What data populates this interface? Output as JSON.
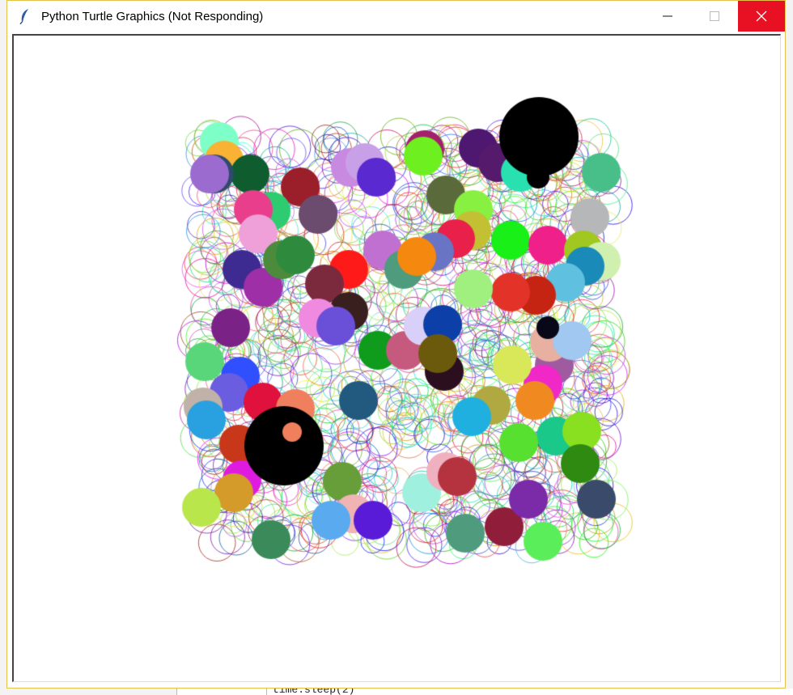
{
  "window": {
    "title": "Python Turtle Graphics (Not Responding)",
    "icon": "feather-icon",
    "controls": {
      "minimize": "minimize-icon",
      "maximize": "maximize-icon",
      "close": "close-icon"
    },
    "close_color": "#e81123"
  },
  "background_editor": {
    "code_line": "time.sleep(2)"
  },
  "canvas": {
    "background": "#ffffff",
    "outline_circles": 900,
    "filled_colors": [
      "#7fffc8",
      "#f9b233",
      "#2d4b6b",
      "#0f5c2f",
      "#9b1f2a",
      "#2ecc71",
      "#e83e8c",
      "#f0a0d8",
      "#6b4c6e",
      "#3d2b91",
      "#9e2fa6",
      "#2e8b3e",
      "#4b8b3b",
      "#ff1a1a",
      "#7b2a3d",
      "#f08ae0",
      "#3a1f1f",
      "#6a4fd9",
      "#7b2287",
      "#5ad67a",
      "#3050ff",
      "#6a5de0",
      "#e0113c",
      "#c0b2a8",
      "#29a0e0",
      "#f07f5e",
      "#c8371a",
      "#e01be0",
      "#d49a2a",
      "#b9e64a",
      "#689e3a",
      "#3a8a5a",
      "#5aaaf0",
      "#f0b4b4",
      "#5a1bd9",
      "#21597f",
      "#0f9b1c",
      "#c65a7e",
      "#d8d0f8",
      "#0d3fa8",
      "#6b5a0c",
      "#2c0f1f",
      "#a0f0e0",
      "#f0b0c0",
      "#b5333e",
      "#4e9b7e",
      "#901e3a",
      "#7b2aa8",
      "#5aee5a",
      "#3a4a6a",
      "#3a8a3a",
      "#fff",
      "#c88ae0",
      "#c8a0e8",
      "#5a2ad0",
      "#a5206a",
      "#6ef020",
      "#4e1870",
      "#551a6b",
      "#28e0b0",
      "#48bf88",
      "#b5b7b9",
      "#5b6a3a",
      "#88f040",
      "#c4c034",
      "#e8204a",
      "#6a74c4",
      "#f5890f",
      "#c070d0",
      "#2bd7e8",
      "#18f018",
      "#f0208a",
      "#a0c820",
      "#d0f0b0",
      "#1a8ab8",
      "#60c0e0",
      "#e33328",
      "#c62412",
      "#a0f080",
      "#d8e858",
      "#a05aa0",
      "#f028c8",
      "#a0c8f0",
      "#e8b0a0",
      "#080818",
      "#b0a840",
      "#f08a20",
      "#1ac88a",
      "#88e020",
      "#2e8a10",
      "#58e030",
      "#20b0e0"
    ],
    "black_circles": 3
  }
}
